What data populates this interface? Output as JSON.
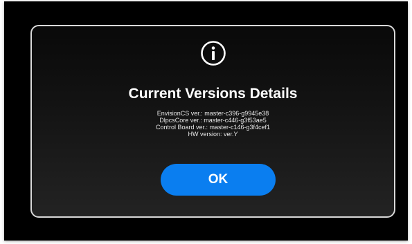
{
  "dialog": {
    "icon": "info-icon",
    "title": "Current Versions Details",
    "details": [
      "EnvisionCS ver.: master-c396-g9945e38",
      "DlpcsCore ver.: master-c446-g3f53ae5",
      "Control Board ver.: master-c146-g3f4cef1",
      "HW version: ver.Y"
    ],
    "ok_label": "OK"
  },
  "colors": {
    "accent": "#0a7ef0",
    "background": "#000000",
    "border": "#d9d9d9",
    "text": "#ffffff"
  }
}
